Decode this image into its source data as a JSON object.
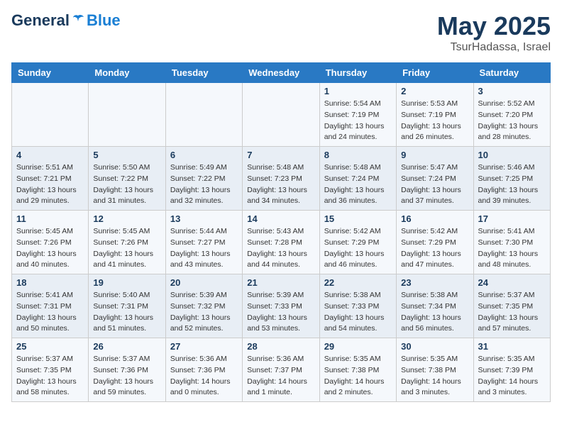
{
  "header": {
    "logo_general": "General",
    "logo_blue": "Blue",
    "month_year": "May 2025",
    "location": "TsurHadassa, Israel"
  },
  "days_of_week": [
    "Sunday",
    "Monday",
    "Tuesday",
    "Wednesday",
    "Thursday",
    "Friday",
    "Saturday"
  ],
  "weeks": [
    [
      {
        "day": "",
        "info": ""
      },
      {
        "day": "",
        "info": ""
      },
      {
        "day": "",
        "info": ""
      },
      {
        "day": "",
        "info": ""
      },
      {
        "day": "1",
        "info": "Sunrise: 5:54 AM\nSunset: 7:19 PM\nDaylight: 13 hours\nand 24 minutes."
      },
      {
        "day": "2",
        "info": "Sunrise: 5:53 AM\nSunset: 7:19 PM\nDaylight: 13 hours\nand 26 minutes."
      },
      {
        "day": "3",
        "info": "Sunrise: 5:52 AM\nSunset: 7:20 PM\nDaylight: 13 hours\nand 28 minutes."
      }
    ],
    [
      {
        "day": "4",
        "info": "Sunrise: 5:51 AM\nSunset: 7:21 PM\nDaylight: 13 hours\nand 29 minutes."
      },
      {
        "day": "5",
        "info": "Sunrise: 5:50 AM\nSunset: 7:22 PM\nDaylight: 13 hours\nand 31 minutes."
      },
      {
        "day": "6",
        "info": "Sunrise: 5:49 AM\nSunset: 7:22 PM\nDaylight: 13 hours\nand 32 minutes."
      },
      {
        "day": "7",
        "info": "Sunrise: 5:48 AM\nSunset: 7:23 PM\nDaylight: 13 hours\nand 34 minutes."
      },
      {
        "day": "8",
        "info": "Sunrise: 5:48 AM\nSunset: 7:24 PM\nDaylight: 13 hours\nand 36 minutes."
      },
      {
        "day": "9",
        "info": "Sunrise: 5:47 AM\nSunset: 7:24 PM\nDaylight: 13 hours\nand 37 minutes."
      },
      {
        "day": "10",
        "info": "Sunrise: 5:46 AM\nSunset: 7:25 PM\nDaylight: 13 hours\nand 39 minutes."
      }
    ],
    [
      {
        "day": "11",
        "info": "Sunrise: 5:45 AM\nSunset: 7:26 PM\nDaylight: 13 hours\nand 40 minutes."
      },
      {
        "day": "12",
        "info": "Sunrise: 5:45 AM\nSunset: 7:26 PM\nDaylight: 13 hours\nand 41 minutes."
      },
      {
        "day": "13",
        "info": "Sunrise: 5:44 AM\nSunset: 7:27 PM\nDaylight: 13 hours\nand 43 minutes."
      },
      {
        "day": "14",
        "info": "Sunrise: 5:43 AM\nSunset: 7:28 PM\nDaylight: 13 hours\nand 44 minutes."
      },
      {
        "day": "15",
        "info": "Sunrise: 5:42 AM\nSunset: 7:29 PM\nDaylight: 13 hours\nand 46 minutes."
      },
      {
        "day": "16",
        "info": "Sunrise: 5:42 AM\nSunset: 7:29 PM\nDaylight: 13 hours\nand 47 minutes."
      },
      {
        "day": "17",
        "info": "Sunrise: 5:41 AM\nSunset: 7:30 PM\nDaylight: 13 hours\nand 48 minutes."
      }
    ],
    [
      {
        "day": "18",
        "info": "Sunrise: 5:41 AM\nSunset: 7:31 PM\nDaylight: 13 hours\nand 50 minutes."
      },
      {
        "day": "19",
        "info": "Sunrise: 5:40 AM\nSunset: 7:31 PM\nDaylight: 13 hours\nand 51 minutes."
      },
      {
        "day": "20",
        "info": "Sunrise: 5:39 AM\nSunset: 7:32 PM\nDaylight: 13 hours\nand 52 minutes."
      },
      {
        "day": "21",
        "info": "Sunrise: 5:39 AM\nSunset: 7:33 PM\nDaylight: 13 hours\nand 53 minutes."
      },
      {
        "day": "22",
        "info": "Sunrise: 5:38 AM\nSunset: 7:33 PM\nDaylight: 13 hours\nand 54 minutes."
      },
      {
        "day": "23",
        "info": "Sunrise: 5:38 AM\nSunset: 7:34 PM\nDaylight: 13 hours\nand 56 minutes."
      },
      {
        "day": "24",
        "info": "Sunrise: 5:37 AM\nSunset: 7:35 PM\nDaylight: 13 hours\nand 57 minutes."
      }
    ],
    [
      {
        "day": "25",
        "info": "Sunrise: 5:37 AM\nSunset: 7:35 PM\nDaylight: 13 hours\nand 58 minutes."
      },
      {
        "day": "26",
        "info": "Sunrise: 5:37 AM\nSunset: 7:36 PM\nDaylight: 13 hours\nand 59 minutes."
      },
      {
        "day": "27",
        "info": "Sunrise: 5:36 AM\nSunset: 7:36 PM\nDaylight: 14 hours\nand 0 minutes."
      },
      {
        "day": "28",
        "info": "Sunrise: 5:36 AM\nSunset: 7:37 PM\nDaylight: 14 hours\nand 1 minute."
      },
      {
        "day": "29",
        "info": "Sunrise: 5:35 AM\nSunset: 7:38 PM\nDaylight: 14 hours\nand 2 minutes."
      },
      {
        "day": "30",
        "info": "Sunrise: 5:35 AM\nSunset: 7:38 PM\nDaylight: 14 hours\nand 3 minutes."
      },
      {
        "day": "31",
        "info": "Sunrise: 5:35 AM\nSunset: 7:39 PM\nDaylight: 14 hours\nand 3 minutes."
      }
    ]
  ]
}
